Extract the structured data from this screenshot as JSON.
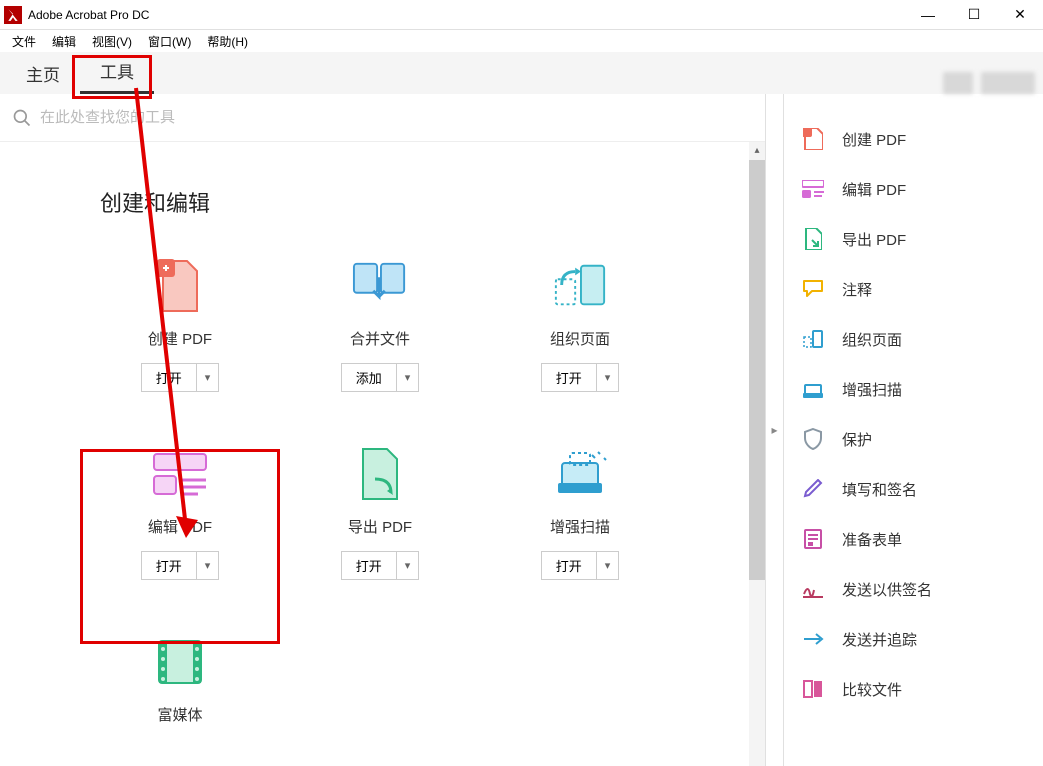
{
  "titlebar": {
    "app_name": "Adobe Acrobat Pro DC"
  },
  "menubar": {
    "items": [
      "文件",
      "编辑",
      "视图(V)",
      "窗口(W)",
      "帮助(H)"
    ]
  },
  "tabs": {
    "home": "主页",
    "tools": "工具"
  },
  "search": {
    "placeholder": "在此处查找您的工具"
  },
  "section": {
    "title": "创建和编辑"
  },
  "tools": [
    {
      "label": "创建 PDF",
      "button": "打开",
      "color": "#f28b82"
    },
    {
      "label": "合并文件",
      "button": "添加",
      "color": "#4fa8e0"
    },
    {
      "label": "组织页面",
      "button": "打开",
      "color": "#57b8d0"
    },
    {
      "label": "编辑 PDF",
      "button": "打开",
      "color": "#e07ae0"
    },
    {
      "label": "导出 PDF",
      "button": "打开",
      "color": "#36c98e"
    },
    {
      "label": "增强扫描",
      "button": "打开",
      "color": "#3aa8d8"
    },
    {
      "label": "富媒体",
      "button": "",
      "color": "#36c98e"
    }
  ],
  "rightpanel": [
    {
      "label": "创建 PDF",
      "color": "#f28b82"
    },
    {
      "label": "编辑 PDF",
      "color": "#e07ae0"
    },
    {
      "label": "导出 PDF",
      "color": "#36c98e"
    },
    {
      "label": "注释",
      "color": "#f7c948"
    },
    {
      "label": "组织页面",
      "color": "#3aa8d8"
    },
    {
      "label": "增强扫描",
      "color": "#3aa8d8"
    },
    {
      "label": "保护",
      "color": "#9aa7b0"
    },
    {
      "label": "填写和签名",
      "color": "#8860d0"
    },
    {
      "label": "准备表单",
      "color": "#d05ab0"
    },
    {
      "label": "发送以供签名",
      "color": "#c04870"
    },
    {
      "label": "发送并追踪",
      "color": "#3aa8d8"
    },
    {
      "label": "比较文件",
      "color": "#e060a0"
    }
  ]
}
